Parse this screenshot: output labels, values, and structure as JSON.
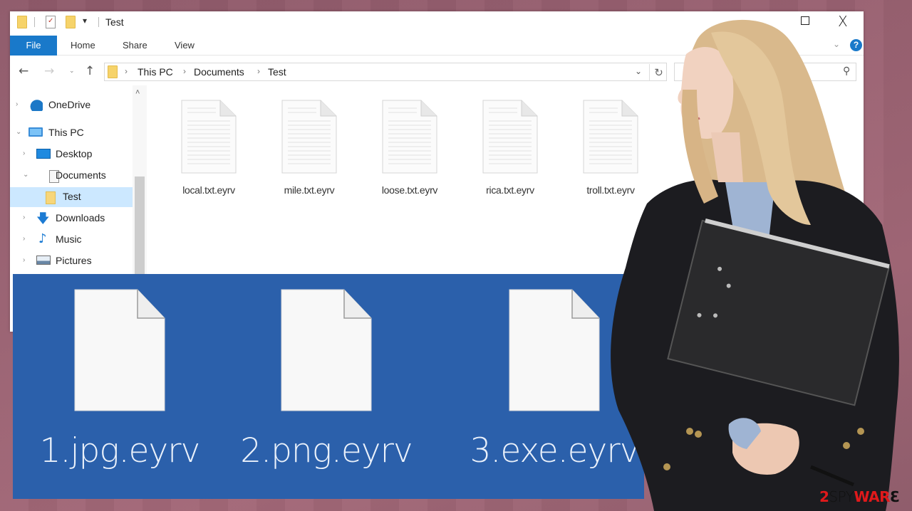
{
  "window": {
    "title": "Test",
    "controls": {
      "maximize_icon": "maximize-icon",
      "close_label": "X"
    }
  },
  "quick_access": {
    "icons": [
      "folder-icon",
      "properties-icon",
      "new-folder-icon"
    ],
    "dropdown_glyph": "▾"
  },
  "ribbon": {
    "tabs": [
      {
        "label": "File",
        "active": true
      },
      {
        "label": "Home"
      },
      {
        "label": "Share"
      },
      {
        "label": "View"
      }
    ],
    "expand_glyph": "⌄",
    "help_glyph": "?"
  },
  "navigation": {
    "back_glyph": "←",
    "forward_glyph": "→",
    "recent_glyph": "⌄",
    "up_glyph": "↑",
    "breadcrumb": [
      "This PC",
      "Documents",
      "Test"
    ],
    "separator": "›",
    "dropdown_glyph": "⌄",
    "refresh_glyph": "↻",
    "search_placeholder": "",
    "search_glyph": "⚲"
  },
  "sidebar": {
    "items": [
      {
        "label": "OneDrive",
        "icon": "onedrive-icon",
        "chevron": "›",
        "level": 0
      },
      {
        "label": "This PC",
        "icon": "pc-icon",
        "chevron": "⌄",
        "level": 0
      },
      {
        "label": "Desktop",
        "icon": "desktop-icon",
        "chevron": "›",
        "level": 1
      },
      {
        "label": "Documents",
        "icon": "documents-icon",
        "chevron": "⌄",
        "level": 1
      },
      {
        "label": "Test",
        "icon": "folder-icon",
        "chevron": "",
        "level": 2,
        "selected": true
      },
      {
        "label": "Downloads",
        "icon": "downloads-icon",
        "chevron": "›",
        "level": 1,
        "glyph": "🡇"
      },
      {
        "label": "Music",
        "icon": "music-icon",
        "chevron": "›",
        "level": 1,
        "glyph": "♪"
      },
      {
        "label": "Pictures",
        "icon": "pictures-icon",
        "chevron": "›",
        "level": 1
      }
    ],
    "scroll_up_glyph": "˄"
  },
  "files": [
    {
      "name": "local.txt.eyrv"
    },
    {
      "name": "mile.txt.eyrv"
    },
    {
      "name": "loose.txt.eyrv"
    },
    {
      "name": "rica.txt.eyrv"
    },
    {
      "name": "troll.txt.eyrv"
    }
  ],
  "highlight_files": [
    {
      "name": "1.jpg.eyrv"
    },
    {
      "name": "2.png.eyrv"
    },
    {
      "name": "3.exe.eyrv"
    }
  ],
  "watermark": {
    "part1": "2",
    "part2": "SPY",
    "part3": "WAR",
    "part4": "Ɛ"
  },
  "colors": {
    "accent": "#1979ca",
    "panel_blue": "#2b60ab",
    "background": "#9a6272",
    "watermark_red": "#e0191b"
  }
}
